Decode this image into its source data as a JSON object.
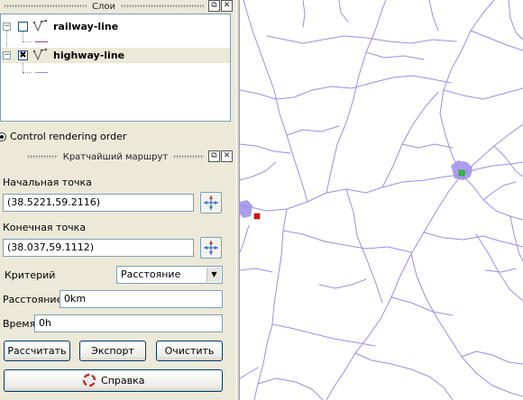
{
  "layers_panel": {
    "title": "Слои",
    "float_icon": "float-window-icon",
    "close_icon": "close-icon",
    "layers": [
      {
        "name": "railway-line",
        "checked": false,
        "expanded": true,
        "icon": "line-layer-icon"
      },
      {
        "name": "highway-line",
        "checked": true,
        "expanded": true,
        "icon": "line-layer-icon"
      }
    ],
    "control_rendering_order": "Control rendering order"
  },
  "route_panel": {
    "title": "Кратчайший маршрут",
    "start_label": "Начальная точка",
    "start_value": "(38.5221,59.2116)",
    "end_label": "Конечная точка",
    "end_value": "(38.037,59.1112)",
    "criterion_label": "Критерий",
    "criterion_value": "Расстояние",
    "distance_label": "Расстояние",
    "distance_value": "0km",
    "time_label": "Время",
    "time_value": "0h",
    "calculate_label": "Рассчитать",
    "export_label": "Экспорт",
    "clear_label": "Очистить",
    "help_label": "Справка",
    "pick_icon": "capture-point-icon",
    "help_icon": "help-icon"
  },
  "map": {
    "line_color": "#9b8ee8",
    "start_marker_color": "#22cc22",
    "end_marker_color": "#dd1111"
  }
}
